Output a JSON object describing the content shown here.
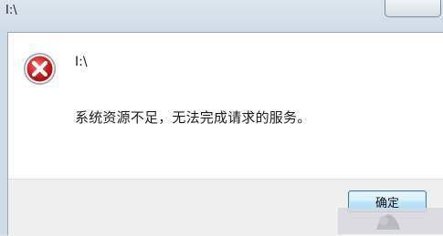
{
  "window": {
    "title": "I:\\"
  },
  "dialog": {
    "icon": "error-icon",
    "heading": "I:\\",
    "message": "系统资源不足，无法完成请求的服务。",
    "ok_label": "确定"
  },
  "colors": {
    "error_red": "#cc1f1f",
    "button_border": "#3c7fb1",
    "footer_bg": "#f0f0f0",
    "frame_bg": "#cfdbe6"
  }
}
